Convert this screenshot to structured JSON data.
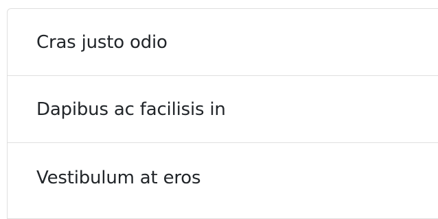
{
  "list": {
    "items": [
      {
        "label": "Cras justo odio"
      },
      {
        "label": "Dapibus ac facilisis in"
      },
      {
        "label": "Vestibulum at eros"
      }
    ]
  }
}
